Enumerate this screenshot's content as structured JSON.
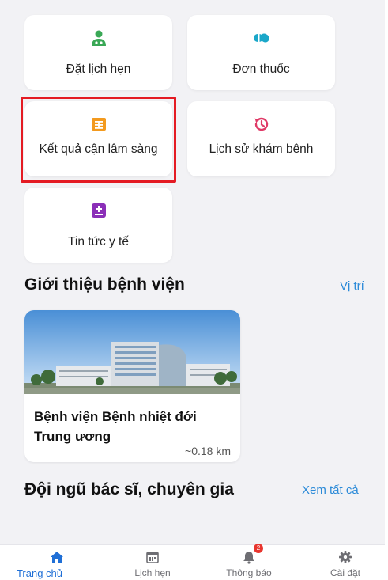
{
  "tiles": [
    {
      "label": "Đặt lịch hẹn",
      "icon": "doctor-icon",
      "color": "#3aa856"
    },
    {
      "label": "Đơn thuốc",
      "icon": "pill-icon",
      "color": "#1aa7c9"
    },
    {
      "label": "Kết quả cận lâm sàng",
      "icon": "lab-result-icon",
      "color": "#f39a1e"
    },
    {
      "label": "Lịch sử khám bênh",
      "icon": "history-icon",
      "color": "#e03a67"
    },
    {
      "label": "Tin tức y tế",
      "icon": "medical-news-icon",
      "color": "#8b2fb8"
    }
  ],
  "intro_section": {
    "title": "Giới thiệu bệnh viện",
    "link": "Vị trí"
  },
  "hospital": {
    "name": "Bệnh viện Bệnh nhiệt đới Trung ương",
    "distance": "~0.18 km"
  },
  "doctors_section": {
    "title": "Đội ngũ bác sĩ, chuyên gia",
    "link": "Xem tất cả"
  },
  "tabs": [
    {
      "label": "Trang chủ",
      "icon": "home-icon",
      "active": true
    },
    {
      "label": "Lịch hẹn",
      "icon": "calendar-icon",
      "active": false
    },
    {
      "label": "Thông báo",
      "icon": "bell-icon",
      "active": false,
      "badge": "2"
    },
    {
      "label": "Cài đặt",
      "icon": "gear-icon",
      "active": false
    }
  ],
  "colors": {
    "accent": "#1f6fd6",
    "link": "#2b8ad8",
    "highlight": "#e41b23",
    "badge": "#e8352e"
  }
}
